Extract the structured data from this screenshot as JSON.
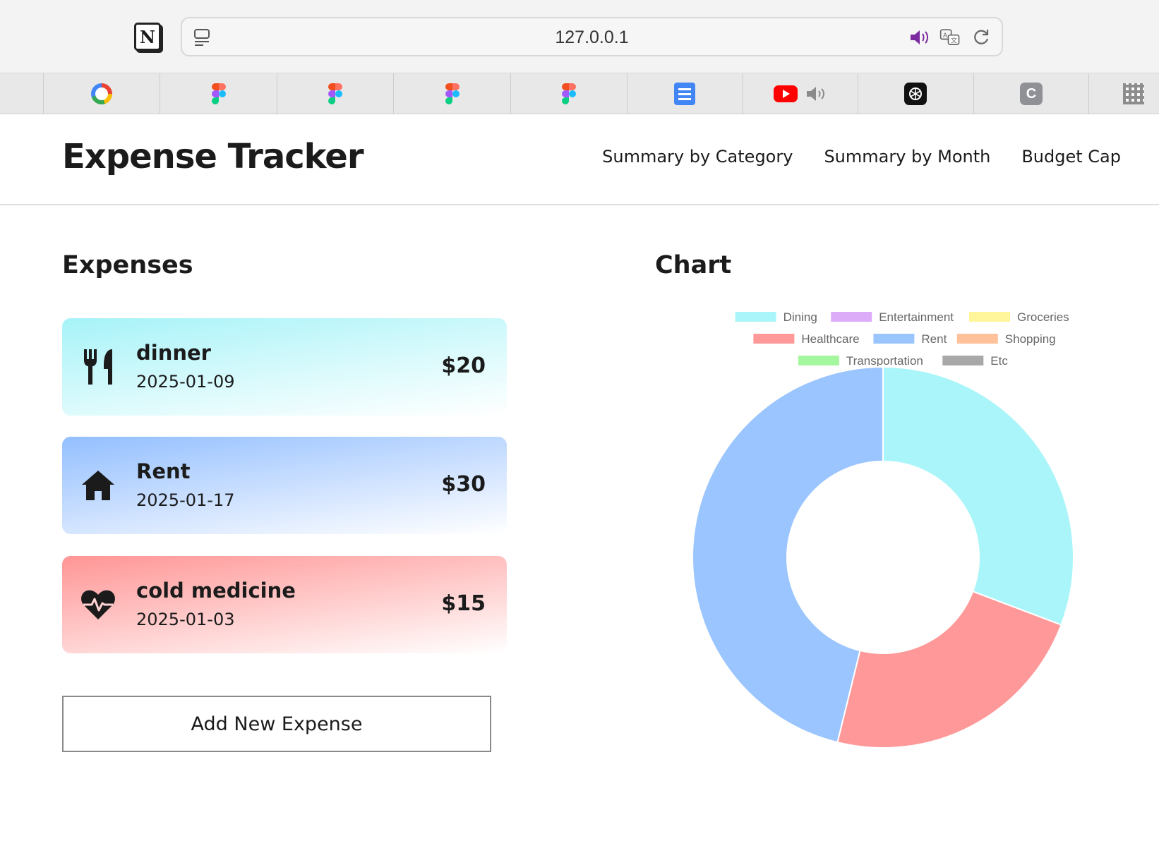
{
  "browser": {
    "url": "127.0.0.1",
    "tabs": [
      "google",
      "figma",
      "figma",
      "figma",
      "figma",
      "google-docs",
      "youtube",
      "chatgpt",
      "c-app",
      "qr"
    ]
  },
  "header": {
    "title": "Expense Tracker",
    "nav": [
      "Summary by Category",
      "Summary by Month",
      "Budget Cap"
    ]
  },
  "expenses": {
    "title": "Expenses",
    "items": [
      {
        "name": "dinner",
        "date": "2025-01-09",
        "amount": "$20",
        "icon": "utensils-icon",
        "category": "Dining"
      },
      {
        "name": "Rent",
        "date": "2025-01-17",
        "amount": "$30",
        "icon": "house-icon",
        "category": "Rent"
      },
      {
        "name": "cold medicine",
        "date": "2025-01-03",
        "amount": "$15",
        "icon": "heartbeat-icon",
        "category": "Healthcare"
      }
    ],
    "add_button": "Add New Expense"
  },
  "chart_section": {
    "title": "Chart"
  },
  "chart_data": {
    "type": "pie",
    "title": "",
    "legend_position": "top",
    "categories": [
      "Dining",
      "Entertainment",
      "Groceries",
      "Healthcare",
      "Rent",
      "Shopping",
      "Transportation",
      "Etc"
    ],
    "values": [
      20,
      0,
      0,
      15,
      30,
      0,
      0,
      0
    ],
    "colors": [
      "#aaf5f9",
      "#ddacf9",
      "#fff59b",
      "#ff9898",
      "#9ac5ff",
      "#ffc19a",
      "#a4f79e",
      "#a8a8a8"
    ]
  }
}
